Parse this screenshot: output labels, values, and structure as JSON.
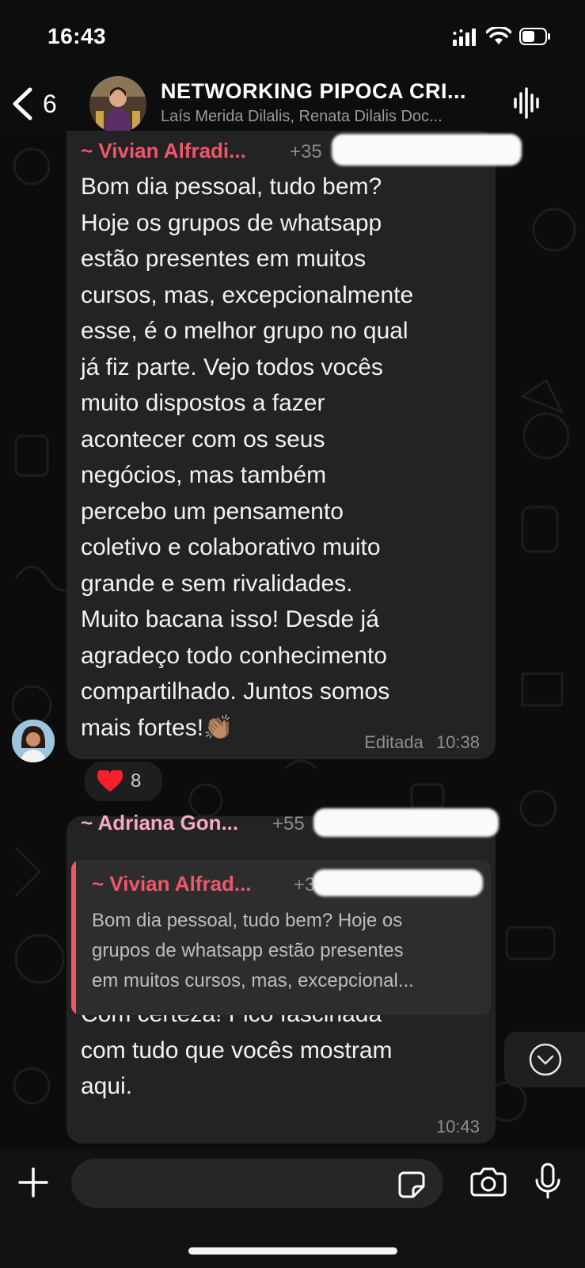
{
  "status_bar": {
    "time": "16:43"
  },
  "header": {
    "back_count": "6",
    "title": "NETWORKING PIPOCA CRI...",
    "members": "Laís Merida Dilalis, Renata Dilalis Doc..."
  },
  "messages": [
    {
      "sender": "~ Vivian Alfradi...",
      "phone": "+35",
      "lines": [
        "Bom dia pessoal, tudo bem?",
        "Hoje os grupos de whatsapp",
        "estão presentes em muitos",
        "cursos, mas, excepcionalmente",
        "esse, é o melhor grupo no qual",
        "já fiz parte. Vejo todos vocês",
        "muito dispostos a fazer",
        "acontecer com os seus",
        "negócios, mas também",
        "percebo um pensamento",
        "coletivo e colaborativo muito",
        "grande e sem rivalidades.",
        "Muito bacana isso! Desde já",
        "agradeço todo conhecimento",
        "compartilhado. Juntos somos",
        "mais fortes!👏🏽"
      ],
      "edited_label": "Editada",
      "time": "10:38",
      "reaction": {
        "emoji": "heart",
        "count": "8"
      }
    },
    {
      "sender": "~ Adriana Gon...",
      "phone": "+55",
      "quote": {
        "sender": "~ Vivian Alfrad...",
        "phone": "+3",
        "lines": [
          "Bom dia pessoal, tudo bem? Hoje os",
          "grupos de whatsapp estão presentes",
          "em muitos cursos, mas, excepcional..."
        ]
      },
      "lines": [
        "Com certeza! Fico fascinada",
        "com tudo que vocês mostram",
        "aqui."
      ],
      "time": "10:43"
    }
  ],
  "composer": {
    "placeholder": ""
  },
  "icons": {
    "back": "chevron-left-icon",
    "voice": "waveform-icon",
    "plus": "plus-icon",
    "sticker": "sticker-icon",
    "camera": "camera-icon",
    "mic": "microphone-icon",
    "scroll": "chevron-down-circle-icon"
  },
  "colors": {
    "sender_vivian": "#f0566a",
    "sender_adriana": "#f7a9c3",
    "bubble": "#232323",
    "quote_bar": "#f0566a"
  }
}
